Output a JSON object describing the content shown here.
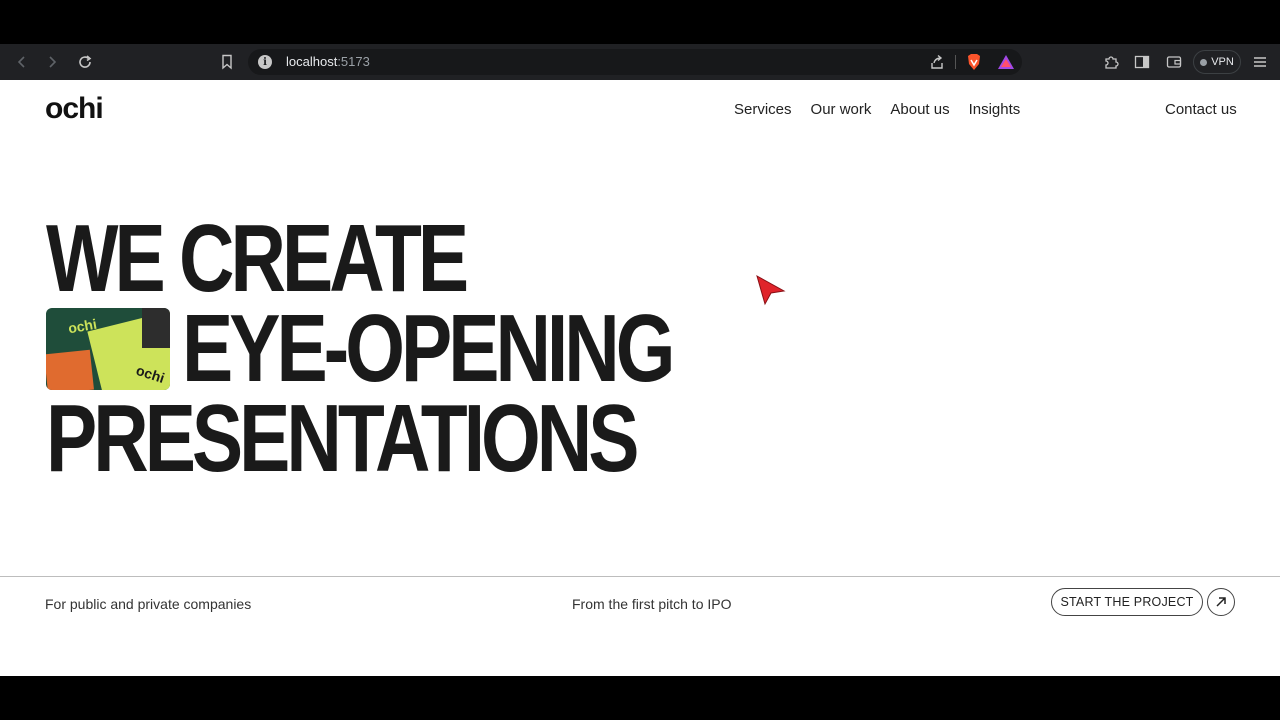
{
  "browser": {
    "url_host": "localhost",
    "url_port": ":5173",
    "vpn_label": "VPN",
    "info_glyph": "i"
  },
  "site": {
    "logo": "ochi",
    "nav": [
      "Services",
      "Our work",
      "About us",
      "Insights"
    ],
    "contact": "Contact us"
  },
  "hero": {
    "line1": "WE CREATE",
    "line2": "EYE-OPENING",
    "line3": "PRESENTATIONS",
    "thumb_logo": "ochi"
  },
  "footer": {
    "left": "For public and private companies",
    "middle": "From the first pitch to IPO",
    "cta_label": "START THE PROJECT"
  },
  "colors": {
    "page_bg": "#ffffff",
    "text": "#1a1a1a",
    "chrome_bg": "#202124",
    "brave_orange": "#fb542b",
    "cursor_red": "#e0242b"
  },
  "icons": [
    "back-icon",
    "forward-icon",
    "reload-icon",
    "bookmark-icon",
    "info-icon",
    "share-icon",
    "brave-shield-icon",
    "brave-rewards-icon",
    "extensions-icon",
    "sidebar-icon",
    "wallet-icon",
    "menu-icon",
    "arrow-up-right-icon"
  ]
}
